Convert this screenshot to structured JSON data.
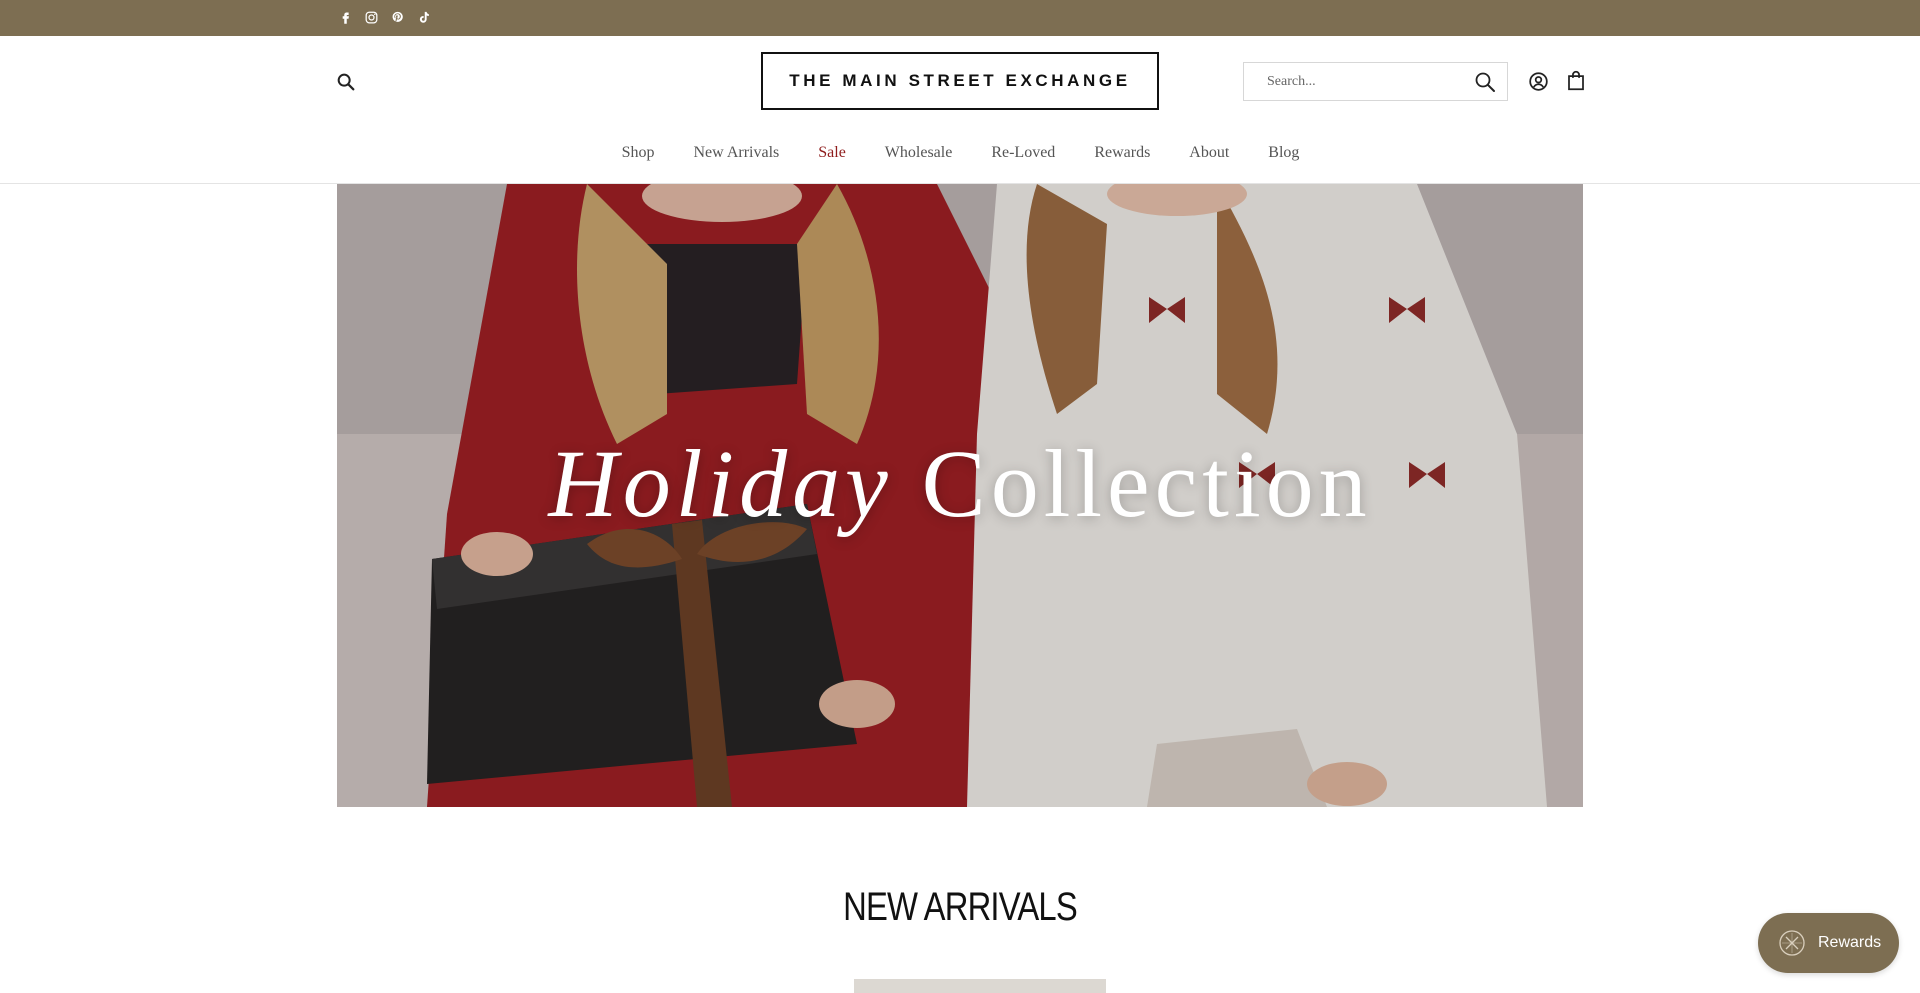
{
  "topbar": {
    "bg_color": "#7d6e52",
    "social_icons": [
      "facebook-icon",
      "instagram-icon",
      "pinterest-icon",
      "tiktok-icon"
    ]
  },
  "header": {
    "logo_text": "THE MAIN STREET EXCHANGE",
    "search_placeholder": "Search...",
    "icons": [
      "search-icon",
      "account-icon",
      "cart-icon"
    ]
  },
  "nav": {
    "items": [
      {
        "label": "Shop"
      },
      {
        "label": "New Arrivals"
      },
      {
        "label": "Sale",
        "color": "#8f1d1d"
      },
      {
        "label": "Wholesale"
      },
      {
        "label": "Re-Loved"
      },
      {
        "label": "Rewards"
      },
      {
        "label": "About"
      },
      {
        "label": "Blog"
      }
    ]
  },
  "hero": {
    "title_italic": "Holiday",
    "title_regular": "Collection"
  },
  "sections": {
    "new_arrivals_title": "NEW ARRIVALS"
  },
  "rewards_widget": {
    "label": "Rewards",
    "bg_color": "#7d6e52"
  }
}
